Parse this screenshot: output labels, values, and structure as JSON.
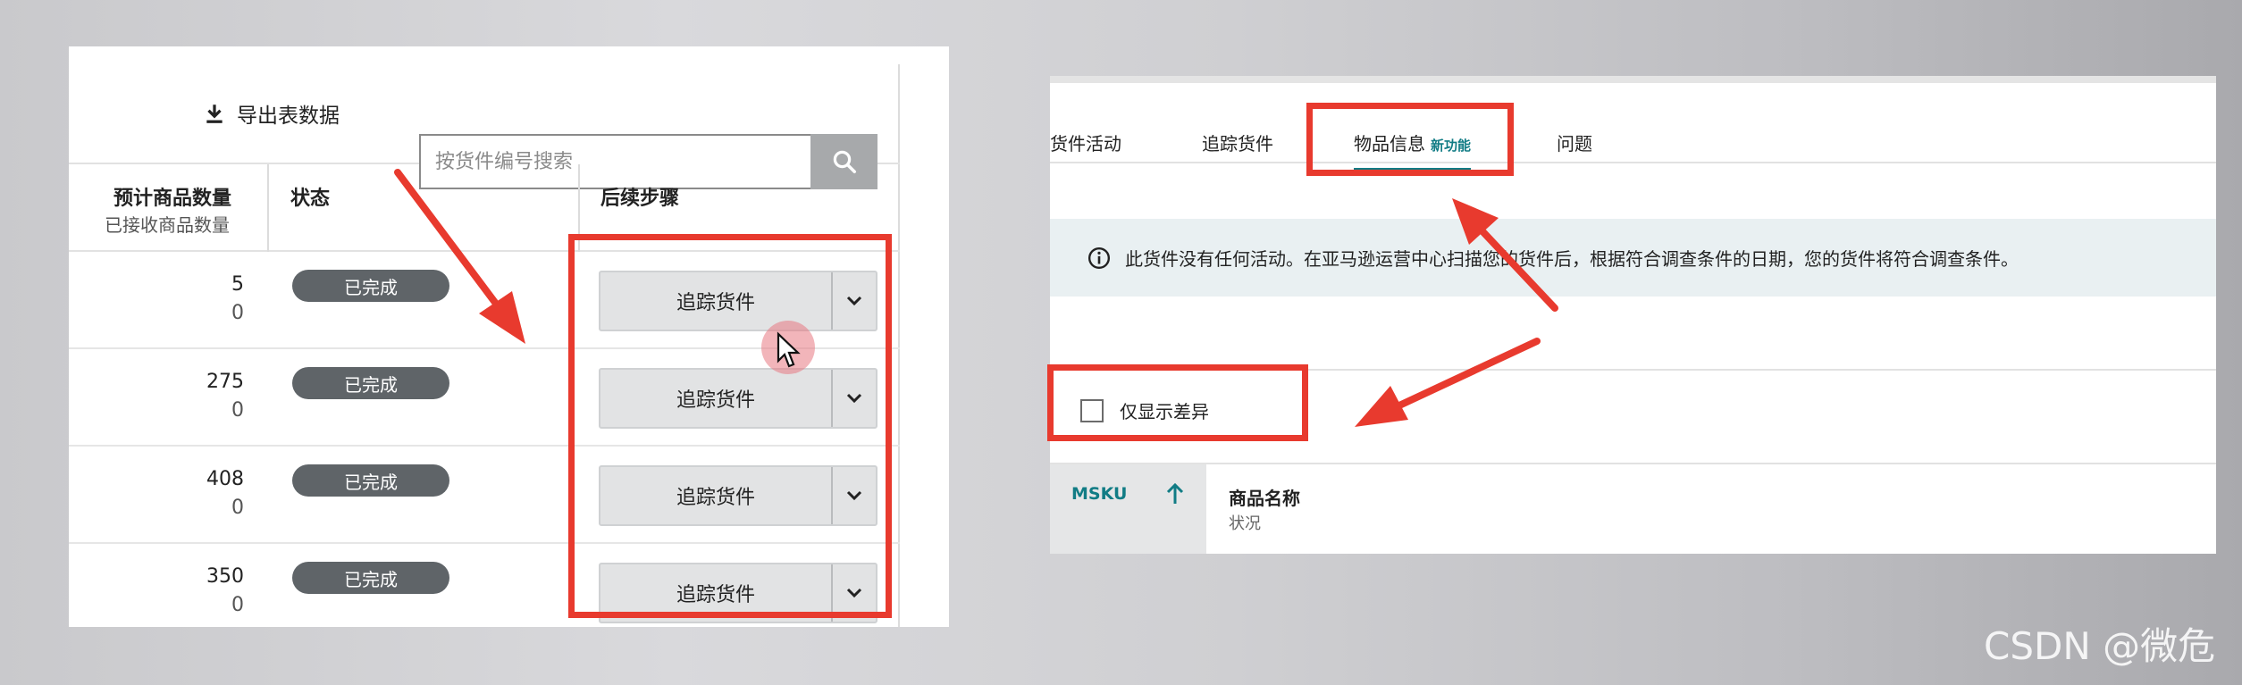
{
  "left": {
    "toolbar": {
      "export_label": "导出表数据",
      "search_placeholder": "按货件编号搜索"
    },
    "headers": {
      "qty": "预计商品数量",
      "qty_sub": "已接收商品数量",
      "status": "状态",
      "next": "后续步骤"
    },
    "rows": [
      {
        "qty": "5",
        "received": "0",
        "status": "已完成",
        "action": "追踪货件"
      },
      {
        "qty": "275",
        "received": "0",
        "status": "已完成",
        "action": "追踪货件"
      },
      {
        "qty": "408",
        "received": "0",
        "status": "已完成",
        "action": "追踪货件"
      },
      {
        "qty": "350",
        "received": "0",
        "status": "已完成",
        "action": "追踪货件"
      }
    ]
  },
  "right": {
    "tabs": [
      {
        "label": "货件活动"
      },
      {
        "label": "追踪货件"
      },
      {
        "label": "物品信息",
        "badge": "新功能"
      },
      {
        "label": "问题"
      }
    ],
    "alert_text": "此货件没有任何活动。在亚马逊运营中心扫描您的货件后，根据符合调查条件的日期，您的货件将符合调查条件。",
    "checkbox_label": "仅显示差异",
    "table": {
      "msku": "MSKU",
      "name": "商品名称",
      "status": "状况"
    }
  },
  "watermark": "CSDN @微危",
  "colors": {
    "annotation_red": "#e83a2e",
    "accent_teal": "#117c85",
    "badge_gray": "#5f6468"
  }
}
